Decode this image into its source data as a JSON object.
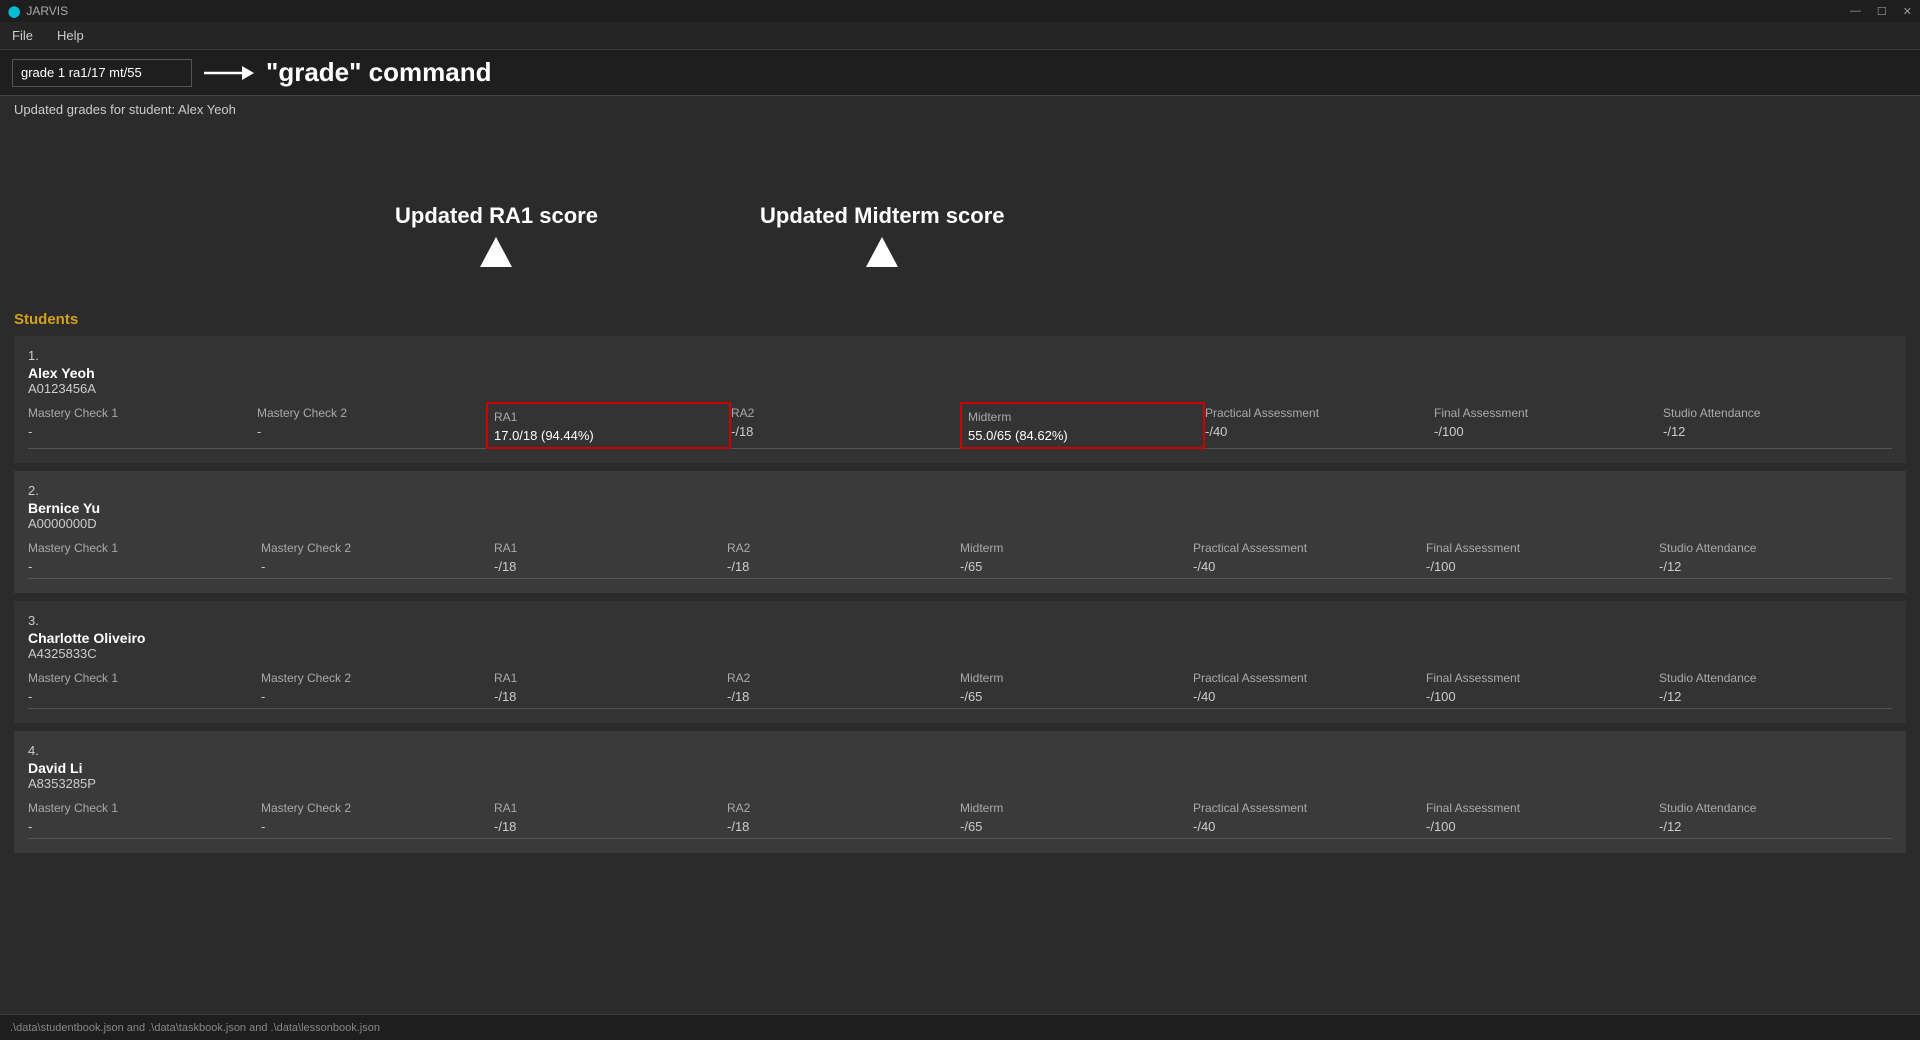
{
  "titleBar": {
    "appName": "JARVIS",
    "windowControls": [
      "—",
      "☐",
      "✕"
    ]
  },
  "menuBar": {
    "items": [
      "File",
      "Help"
    ]
  },
  "commandBar": {
    "inputValue": "grade 1 ra1/17 mt/55",
    "commandLabel": "\"grade\" command"
  },
  "statusMessage": "Updated grades for student: Alex Yeoh",
  "studentsHeader": "Students",
  "annotations": {
    "ra1Label": "Updated RA1 score",
    "midtermLabel": "Updated Midterm score"
  },
  "students": [
    {
      "num": "1.",
      "name": "Alex Yeoh",
      "id": "A0123456A",
      "grades": [
        {
          "header": "Mastery Check 1",
          "value": "-",
          "highlighted": false
        },
        {
          "header": "Mastery Check 2",
          "value": "-",
          "highlighted": false
        },
        {
          "header": "RA1",
          "value": "17.0/18 (94.44%)",
          "highlighted": true
        },
        {
          "header": "RA2",
          "value": "-/18",
          "highlighted": false
        },
        {
          "header": "Midterm",
          "value": "55.0/65 (84.62%)",
          "highlighted": true
        },
        {
          "header": "Practical Assessment",
          "value": "-/40",
          "highlighted": false
        },
        {
          "header": "Final Assessment",
          "value": "-/100",
          "highlighted": false
        },
        {
          "header": "Studio Attendance",
          "value": "-/12",
          "highlighted": false
        }
      ]
    },
    {
      "num": "2.",
      "name": "Bernice Yu",
      "id": "A0000000D",
      "grades": [
        {
          "header": "Mastery Check 1",
          "value": "-",
          "highlighted": false
        },
        {
          "header": "Mastery Check 2",
          "value": "-",
          "highlighted": false
        },
        {
          "header": "RA1",
          "value": "-/18",
          "highlighted": false
        },
        {
          "header": "RA2",
          "value": "-/18",
          "highlighted": false
        },
        {
          "header": "Midterm",
          "value": "-/65",
          "highlighted": false
        },
        {
          "header": "Practical Assessment",
          "value": "-/40",
          "highlighted": false
        },
        {
          "header": "Final Assessment",
          "value": "-/100",
          "highlighted": false
        },
        {
          "header": "Studio Attendance",
          "value": "-/12",
          "highlighted": false
        }
      ]
    },
    {
      "num": "3.",
      "name": "Charlotte Oliveiro",
      "id": "A4325833C",
      "grades": [
        {
          "header": "Mastery Check 1",
          "value": "-",
          "highlighted": false
        },
        {
          "header": "Mastery Check 2",
          "value": "-",
          "highlighted": false
        },
        {
          "header": "RA1",
          "value": "-/18",
          "highlighted": false
        },
        {
          "header": "RA2",
          "value": "-/18",
          "highlighted": false
        },
        {
          "header": "Midterm",
          "value": "-/65",
          "highlighted": false
        },
        {
          "header": "Practical Assessment",
          "value": "-/40",
          "highlighted": false
        },
        {
          "header": "Final Assessment",
          "value": "-/100",
          "highlighted": false
        },
        {
          "header": "Studio Attendance",
          "value": "-/12",
          "highlighted": false
        }
      ]
    },
    {
      "num": "4.",
      "name": "David Li",
      "id": "A8353285P",
      "grades": [
        {
          "header": "Mastery Check 1",
          "value": "-",
          "highlighted": false
        },
        {
          "header": "Mastery Check 2",
          "value": "-",
          "highlighted": false
        },
        {
          "header": "RA1",
          "value": "-/18",
          "highlighted": false
        },
        {
          "header": "RA2",
          "value": "-/18",
          "highlighted": false
        },
        {
          "header": "Midterm",
          "value": "-/65",
          "highlighted": false
        },
        {
          "header": "Practical Assessment",
          "value": "-/40",
          "highlighted": false
        },
        {
          "header": "Final Assessment",
          "value": "-/100",
          "highlighted": false
        },
        {
          "header": "Studio Attendance",
          "value": "-/12",
          "highlighted": false
        }
      ]
    }
  ],
  "bottomBar": {
    "text": ".\\data\\studentbook.json and .\\data\\taskbook.json and .\\data\\lessonbook.json"
  }
}
